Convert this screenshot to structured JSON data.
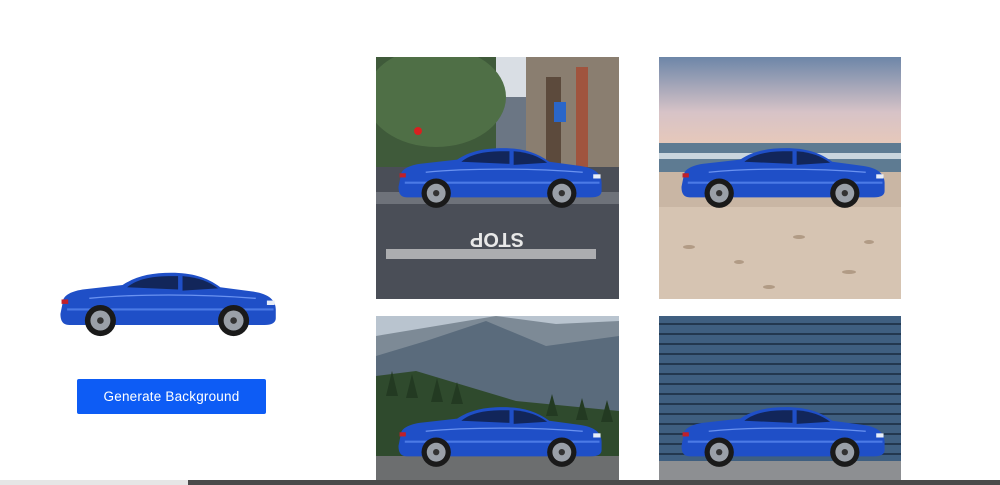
{
  "source": {
    "image_name": "blue-coupe-cutout"
  },
  "actions": {
    "generate_label": "Generate Background"
  },
  "results": [
    {
      "scene": "city-street"
    },
    {
      "scene": "beach"
    },
    {
      "scene": "mountains"
    },
    {
      "scene": "metal-shutter"
    }
  ],
  "colors": {
    "button": "#0d5cf5",
    "car_body": "#1f4fc7"
  }
}
